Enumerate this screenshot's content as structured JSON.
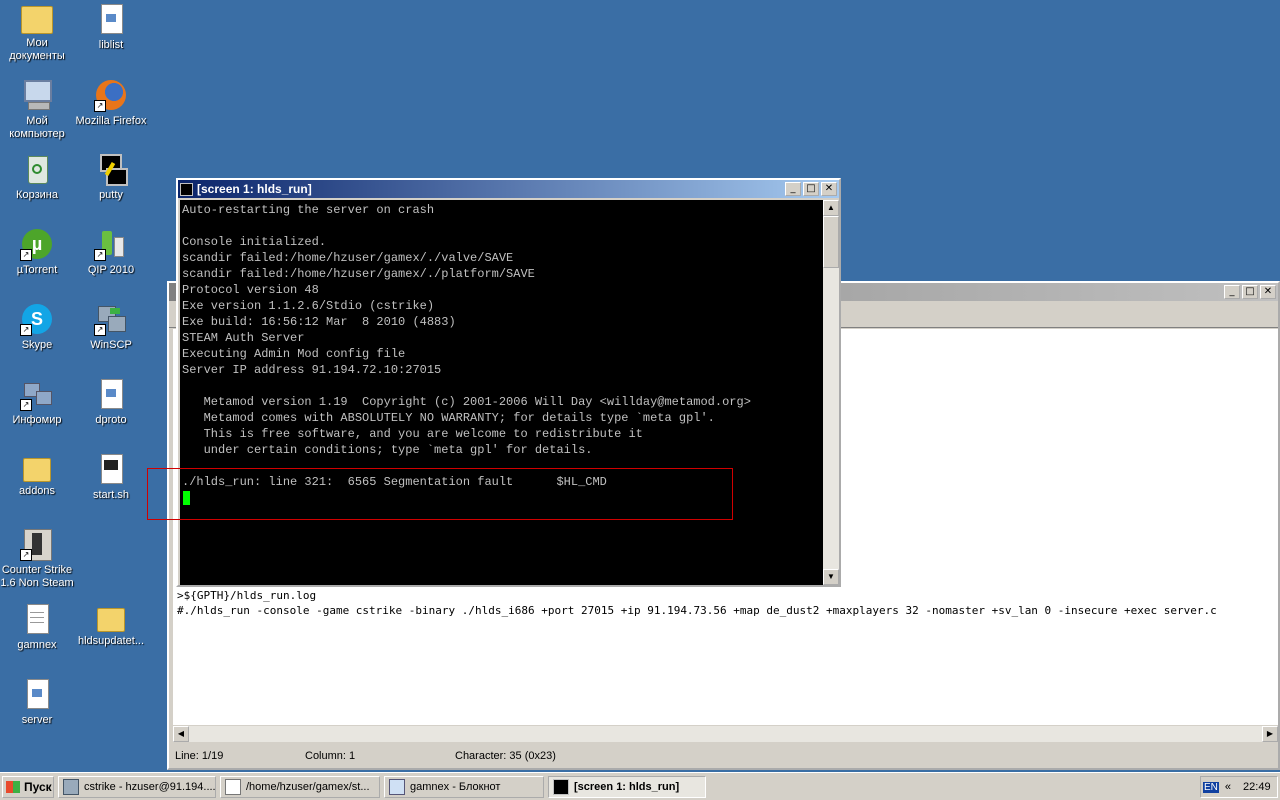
{
  "desktop": {
    "icons": [
      {
        "label": "Мои документы",
        "icon": "my-documents-icon"
      },
      {
        "label": "liblist",
        "icon": "text-file-icon"
      },
      {
        "label": "Мой компьютер",
        "icon": "my-computer-icon"
      },
      {
        "label": "Mozilla Firefox",
        "icon": "firefox-icon"
      },
      {
        "label": "Корзина",
        "icon": "recycle-bin-icon"
      },
      {
        "label": "putty",
        "icon": "putty-icon"
      },
      {
        "label": "µTorrent",
        "icon": "utorrent-icon"
      },
      {
        "label": "QIP 2010",
        "icon": "qip-icon"
      },
      {
        "label": "Skype",
        "icon": "skype-icon"
      },
      {
        "label": "WinSCP",
        "icon": "winscp-icon"
      },
      {
        "label": "Инфомир",
        "icon": "network-icon"
      },
      {
        "label": "dproto",
        "icon": "text-file-icon"
      },
      {
        "label": "addons",
        "icon": "folder-icon"
      },
      {
        "label": "start.sh",
        "icon": "script-file-icon"
      },
      {
        "label": "Counter Strike 1.6 Non Steam",
        "icon": "counter-strike-icon"
      },
      {
        "label": "gamnex",
        "icon": "notepad-file-icon"
      },
      {
        "label": "hldsupdatet...",
        "icon": "folder-icon"
      },
      {
        "label": "server",
        "icon": "text-file-icon"
      }
    ]
  },
  "editor": {
    "lines": [
      ">${GPTH}/hlds_run.log",
      "#./hlds_run -console -game cstrike -binary ./hlds_i686 +port 27015 +ip 91.194.73.56 +map de_dust2 +maxplayers 32 -nomaster +sv_lan 0 -insecure +exec server.c"
    ],
    "status": {
      "line": "Line: 1/19",
      "column": "Column: 1",
      "character": "Character: 35 (0x23)"
    }
  },
  "terminal": {
    "title": "[screen 1: hlds_run]",
    "lines": [
      "Auto-restarting the server on crash",
      "",
      "Console initialized.",
      "scandir failed:/home/hzuser/gamex/./valve/SAVE",
      "scandir failed:/home/hzuser/gamex/./platform/SAVE",
      "Protocol version 48",
      "Exe version 1.1.2.6/Stdio (cstrike)",
      "Exe build: 16:56:12 Mar  8 2010 (4883)",
      "STEAM Auth Server",
      "Executing Admin Mod config file",
      "Server IP address 91.194.72.10:27015",
      "",
      "   Metamod version 1.19  Copyright (c) 2001-2006 Will Day <willday@metamod.org>",
      "   Metamod comes with ABSOLUTELY NO WARRANTY; for details type `meta gpl'.",
      "   This is free software, and you are welcome to redistribute it",
      "   under certain conditions; type `meta gpl' for details.",
      "",
      "./hlds_run: line 321:  6565 Segmentation fault      $HL_CMD"
    ],
    "cursor_color": "#00ff00",
    "highlight_color": "#d00000"
  },
  "taskbar": {
    "start_label": "Пуск",
    "tasks": [
      {
        "label": "cstrike - hzuser@91.194...."
      },
      {
        "label": "/home/hzuser/gamex/st..."
      },
      {
        "label": "gamnex - Блокнот"
      },
      {
        "label": "[screen 1: hlds_run]"
      }
    ],
    "lang": "EN",
    "tray_expand": "«",
    "clock": "22:49"
  },
  "colors": {
    "desktop": "#3a6ea5",
    "title_active": "#0a246a",
    "window_face": "#d4d0c8"
  }
}
